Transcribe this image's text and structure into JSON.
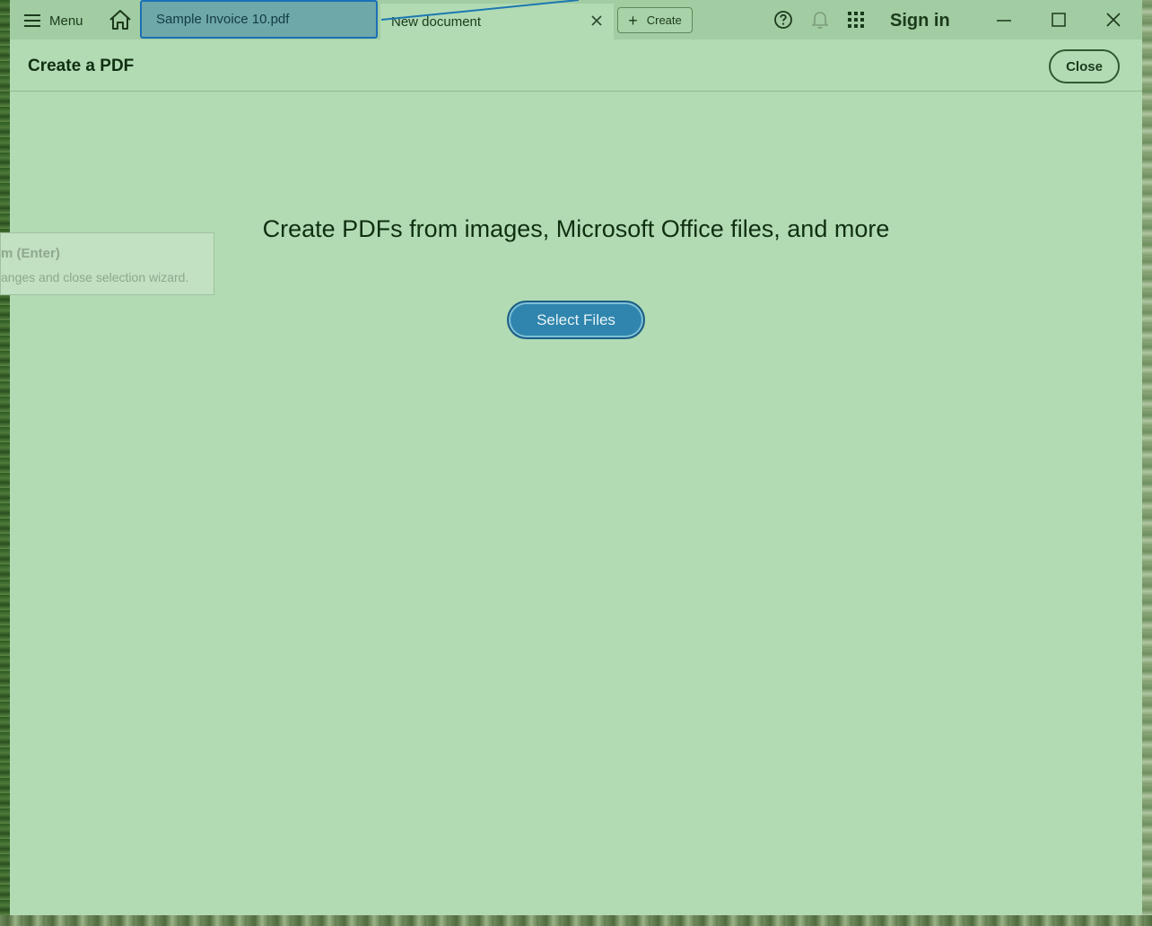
{
  "titlebar": {
    "menu_label": "Menu",
    "tabs": [
      {
        "label": "Sample Invoice 10.pdf",
        "active": true
      },
      {
        "label": "New document",
        "active": false
      }
    ],
    "create_label": "Create",
    "sign_in_label": "Sign in"
  },
  "tool": {
    "title": "Create a PDF",
    "close_label": "Close"
  },
  "tooltip": {
    "line1": "m (Enter)",
    "line2": "anges and close selection wizard."
  },
  "main": {
    "heading": "Create PDFs from images, Microsoft Office files, and more",
    "select_files_label": "Select Files"
  },
  "colors": {
    "window_bg": "#b2dbb4",
    "titlebar_bg": "#a2cca2",
    "active_tab_bg": "#6fa8a9",
    "active_tab_border": "#1b6fb8",
    "primary_button": "#2f85ad"
  },
  "icons": [
    "hamburger-icon",
    "home-icon",
    "close-icon",
    "plus-icon",
    "help-icon",
    "bell-icon",
    "apps-grid-icon",
    "minimize-icon",
    "maximize-icon",
    "window-close-icon"
  ]
}
